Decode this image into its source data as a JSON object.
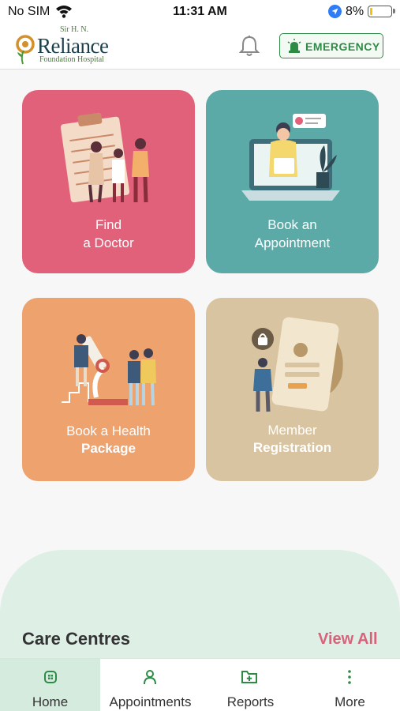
{
  "status_bar": {
    "carrier": "No SIM",
    "time": "11:31 AM",
    "battery": "8%"
  },
  "header": {
    "logo_prefix": "Sir H. N.",
    "logo_name": "Reliance",
    "logo_sub": "Foundation Hospital",
    "emergency_label": "EMERGENCY",
    "icons": [
      "bell-icon",
      "siren-icon"
    ]
  },
  "cards": [
    {
      "line1": "Find",
      "line2": "a Doctor",
      "color": "#e2617a"
    },
    {
      "line1": "Book an",
      "line2": "Appointment",
      "color": "#5baaa7"
    },
    {
      "line1": "Book a Health",
      "line2": "Package",
      "color": "#eea26e"
    },
    {
      "line1": "Member",
      "line2": "Registration",
      "color": "#d8c4a0"
    }
  ],
  "care_centres": {
    "title": "Care Centres",
    "view_all": "View All"
  },
  "bottom_nav": [
    {
      "label": "Home",
      "icon": "home-grid-icon",
      "active": true
    },
    {
      "label": "Appointments",
      "icon": "person-icon",
      "active": false
    },
    {
      "label": "Reports",
      "icon": "folder-plus-icon",
      "active": false
    },
    {
      "label": "More",
      "icon": "more-vertical-icon",
      "active": false
    }
  ],
  "colors": {
    "accent_green": "#2e8b46",
    "view_all_pink": "#d9627a",
    "nav_active": "#d5ebdd"
  }
}
